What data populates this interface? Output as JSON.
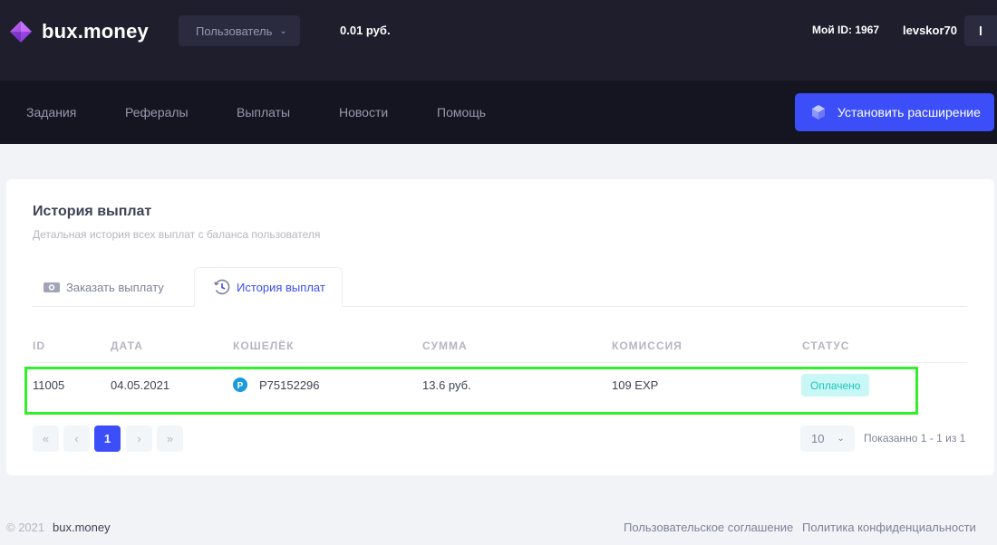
{
  "header": {
    "brand": "bux.money",
    "user_dropdown": "Пользователь",
    "balance": "0.01 руб.",
    "my_id": "Мой ID: 1967",
    "username": "levskor70",
    "avatar_letter": "l"
  },
  "nav": {
    "items": [
      "Задания",
      "Рефералы",
      "Выплаты",
      "Новости",
      "Помощь"
    ],
    "install_label": "Установить расширение"
  },
  "card": {
    "title": "История выплат",
    "subtitle": "Детальная история всех выплат с баланса пользователя",
    "tabs": [
      {
        "label": "Заказать выплату",
        "icon": "camera-icon"
      },
      {
        "label": "История выплат",
        "icon": "history-icon",
        "active": true
      }
    ]
  },
  "table": {
    "headers": [
      "ID",
      "ДАТА",
      "КОШЕЛЁК",
      "СУММА",
      "КОМИССИЯ",
      "СТАТУС"
    ],
    "rows": [
      {
        "id": "11005",
        "date": "04.05.2021",
        "wallet": "P75152296",
        "amount": "13.6 руб.",
        "commission": "109 EXP",
        "status": "Оплачено"
      }
    ]
  },
  "pagination": {
    "first": "«",
    "prev": "‹",
    "current": "1",
    "next": "›",
    "last": "»",
    "per_page": "10",
    "info": "Показанно 1 - 1 из 1"
  },
  "footer": {
    "copyright": "© 2021",
    "brand": "bux.money",
    "links": [
      "Пользовательское соглашение",
      "Политика конфиденциальности"
    ]
  },
  "colors": {
    "accent": "#3b4ef8",
    "header_bg": "#1e1e2d",
    "nav_bg": "#151521",
    "status_paid_bg": "#c9f7f5",
    "status_paid_text": "#1bc5bd",
    "highlight": "#33ee2a"
  }
}
